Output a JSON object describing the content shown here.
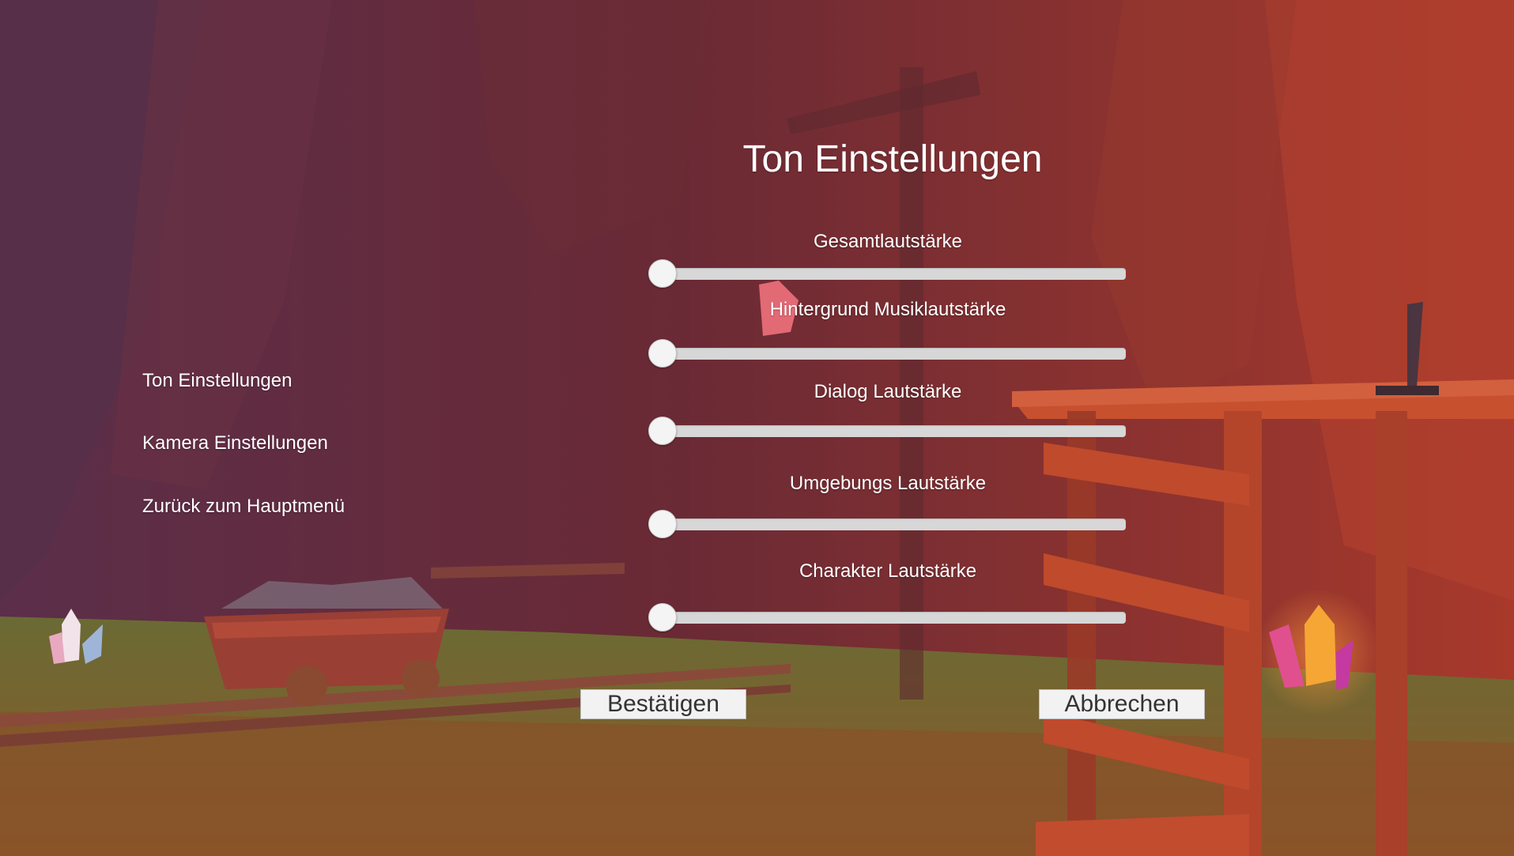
{
  "title": "Ton Einstellungen",
  "side_menu": {
    "items": [
      {
        "label": "Ton Einstellungen"
      },
      {
        "label": "Kamera Einstellungen"
      },
      {
        "label": "Zurück zum Hauptmenü"
      }
    ]
  },
  "sliders": [
    {
      "label": "Gesamtlautstärke",
      "value": 0
    },
    {
      "label": "Hintergrund Musiklautstärke",
      "value": 0
    },
    {
      "label": "Dialog Lautstärke",
      "value": 0
    },
    {
      "label": "Umgebungs Lautstärke",
      "value": 0
    },
    {
      "label": "Charakter Lautstärke",
      "value": 0
    }
  ],
  "buttons": {
    "confirm_label": "Bestätigen",
    "cancel_label": "Abbrechen"
  },
  "colors": {
    "background_top": "#5e2a36",
    "background_right": "#a33a2c",
    "ground": "#7a6a2e",
    "wood": "#b6452a",
    "text": "#ffffff"
  }
}
